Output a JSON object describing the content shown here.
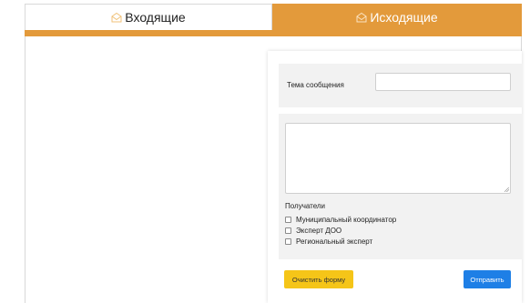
{
  "tabs": [
    {
      "label": "Входящие",
      "icon": "envelope-icon",
      "active": false
    },
    {
      "label": "Исходящие",
      "icon": "open-envelope-icon",
      "active": true
    }
  ],
  "colors": {
    "accent": "#e39a3b",
    "clear_button": "#f5c518",
    "send_button": "#1e7fe6"
  },
  "form": {
    "subject_label": "Тема сообщения",
    "subject_value": "",
    "message_value": "",
    "recipients_label": "Получатели",
    "recipients": [
      {
        "label": "Муниципальный координатор",
        "checked": false
      },
      {
        "label": "Эксперт ДОО",
        "checked": false
      },
      {
        "label": "Региональный эксперт",
        "checked": false
      }
    ],
    "clear_label": "Очистить форму",
    "send_label": "Отправить"
  }
}
